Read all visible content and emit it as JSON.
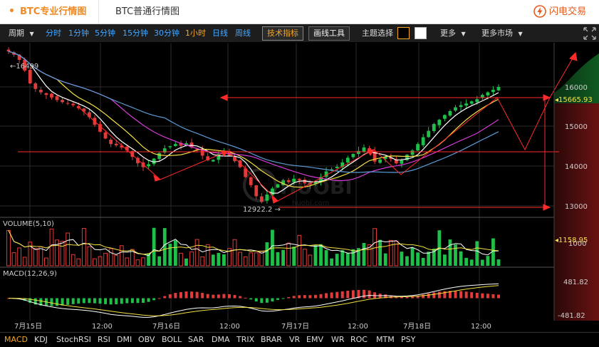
{
  "tabs": {
    "active": "BTC专业行情图",
    "normal": "BTC普通行情图",
    "dot": "•"
  },
  "brand": {
    "name": "闪电交易"
  },
  "toolbar": {
    "period_label": "周期",
    "periods": [
      "分时",
      "1分钟",
      "5分钟",
      "15分钟",
      "30分钟",
      "1小时",
      "日线",
      "周线"
    ],
    "selected_period": "1小时",
    "tech_btn": "技术指标",
    "draw_btn": "画线工具",
    "theme_label": "主题选择",
    "more": "更多",
    "more_markets": "更多市场"
  },
  "watermark": {
    "line1": "HUOBI",
    "line2": "huobi.com"
  },
  "price_axis": {
    "ticks": [
      "16000",
      "15000",
      "14000",
      "13000"
    ],
    "current": "15665.93"
  },
  "volume_axis": {
    "ticks": [
      "1000"
    ],
    "current": "1158.95"
  },
  "macd_axis": {
    "top": "481.82",
    "bottom": "-481.82"
  },
  "labels": {
    "high": "16499",
    "low": "12922.2",
    "volume": "VOLUME(5,10)",
    "macd": "MACD(12,26,9)"
  },
  "x_axis": [
    "7月15日",
    "12:00",
    "7月16日",
    "12:00",
    "7月17日",
    "12:00",
    "7月18日",
    "12:00"
  ],
  "indicators": [
    "MACD",
    "KDJ",
    "StochRSI",
    "RSI",
    "DMI",
    "OBV",
    "BOLL",
    "SAR",
    "DMA",
    "TRIX",
    "BRAR",
    "VR",
    "EMV",
    "WR",
    "ROC",
    "MTM",
    "PSY"
  ],
  "active_indicator": "MACD",
  "colors": {
    "up": "#1fbf4a",
    "down": "#e23b3b",
    "ma5": "#ffffff",
    "ma10": "#f5e042",
    "ma20": "#d63bd6",
    "ma30": "#5b9bd5",
    "accent": "#f5a623",
    "annotation": "#ff2a2a"
  },
  "chart_data": {
    "type": "candlestick",
    "interval": "1小时",
    "price_range": [
      12700,
      16700
    ],
    "closes": [
      16499,
      16420,
      16300,
      16050,
      15750,
      15620,
      15540,
      15480,
      15420,
      15360,
      15310,
      15290,
      15240,
      15170,
      15090,
      14960,
      14780,
      14620,
      14460,
      14330,
      14300,
      14250,
      14180,
      14030,
      13880,
      13790,
      13860,
      13990,
      14120,
      14230,
      14280,
      14330,
      14290,
      14350,
      14250,
      14210,
      14060,
      13950,
      13960,
      14100,
      14180,
      14060,
      13930,
      13790,
      13560,
      13370,
      13110,
      12980,
      13150,
      13290,
      13390,
      13480,
      13440,
      13520,
      13490,
      13410,
      13380,
      13440,
      13560,
      13690,
      13740,
      13800,
      13900,
      14010,
      14100,
      14170,
      14250,
      14190,
      13920,
      13970,
      14030,
      13980,
      13880,
      13950,
      14080,
      14180,
      14330,
      14490,
      14640,
      14800,
      14900,
      15010,
      15100,
      15190,
      15240,
      15280,
      15330,
      15380,
      15480,
      15540,
      15600,
      15666
    ],
    "high_label": 16499,
    "low_label": 12922.2,
    "current_price": 15665.93,
    "volume_current": 1158.95,
    "macd_range": [
      -481.82,
      481.82
    ]
  }
}
